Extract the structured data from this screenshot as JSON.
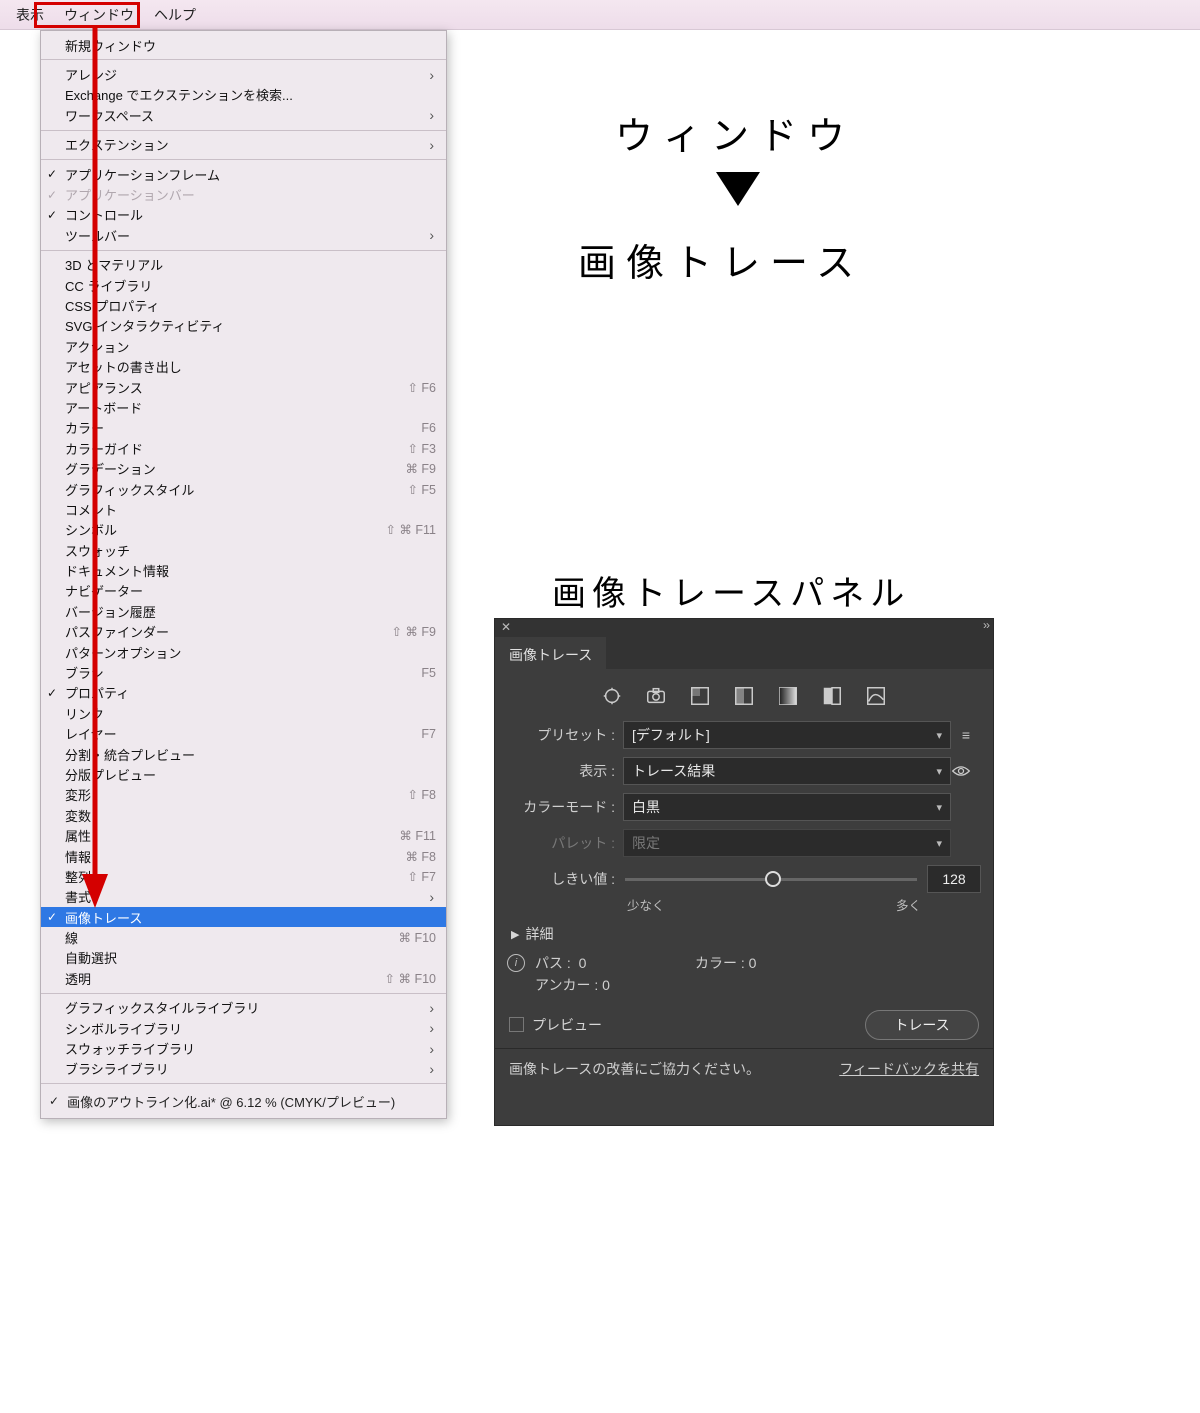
{
  "menubar": {
    "items": [
      "表示",
      "ウィンドウ",
      "ヘルプ"
    ]
  },
  "annotations": {
    "label1": "ウィンドウ",
    "label2": "画像トレース",
    "panel_title": "画像トレースパネル"
  },
  "menu": {
    "footer": "画像のアウトライン化.ai* @ 6.12 % (CMYK/プレビュー)",
    "items": [
      {
        "label": "新規ウィンドウ"
      },
      {
        "sep": true
      },
      {
        "label": "アレンジ",
        "arrow": true
      },
      {
        "label": "Exchange でエクステンションを検索..."
      },
      {
        "label": "ワークスペース",
        "arrow": true
      },
      {
        "sep": true
      },
      {
        "label": "エクステンション",
        "arrow": true
      },
      {
        "sep": true
      },
      {
        "label": "アプリケーションフレーム",
        "check": true
      },
      {
        "label": "アプリケーションバー",
        "check": true,
        "disabled": true
      },
      {
        "label": "コントロール",
        "check": true
      },
      {
        "label": "ツールバー",
        "arrow": true
      },
      {
        "sep": true
      },
      {
        "label": "3D とマテリアル"
      },
      {
        "label": "CC ライブラリ"
      },
      {
        "label": "CSS プロパティ"
      },
      {
        "label": "SVG インタラクティビティ"
      },
      {
        "label": "アクション"
      },
      {
        "label": "アセットの書き出し"
      },
      {
        "label": "アピアランス",
        "shortcut": "⇧ F6"
      },
      {
        "label": "アートボード"
      },
      {
        "label": "カラー",
        "shortcut": "F6"
      },
      {
        "label": "カラーガイド",
        "shortcut": "⇧ F3"
      },
      {
        "label": "グラデーション",
        "shortcut": "⌘ F9"
      },
      {
        "label": "グラフィックスタイル",
        "shortcut": "⇧ F5"
      },
      {
        "label": "コメント"
      },
      {
        "label": "シンボル",
        "shortcut": "⇧ ⌘ F11"
      },
      {
        "label": "スウォッチ"
      },
      {
        "label": "ドキュメント情報"
      },
      {
        "label": "ナビゲーター"
      },
      {
        "label": "バージョン履歴"
      },
      {
        "label": "パスファインダー",
        "shortcut": "⇧ ⌘ F9"
      },
      {
        "label": "パターンオプション"
      },
      {
        "label": "ブラシ",
        "shortcut": "F5"
      },
      {
        "label": "プロパティ",
        "check": true
      },
      {
        "label": "リンク"
      },
      {
        "label": "レイヤー",
        "shortcut": "F7"
      },
      {
        "label": "分割・統合プレビュー"
      },
      {
        "label": "分版プレビュー"
      },
      {
        "label": "変形",
        "shortcut": "⇧ F8"
      },
      {
        "label": "変数"
      },
      {
        "label": "属性",
        "shortcut": "⌘ F11"
      },
      {
        "label": "情報",
        "shortcut": "⌘ F8"
      },
      {
        "label": "整列",
        "shortcut": "⇧ F7"
      },
      {
        "label": "書式",
        "arrow": true
      },
      {
        "label": "画像トレース",
        "check": true,
        "selected": true
      },
      {
        "label": "線",
        "shortcut": "⌘ F10"
      },
      {
        "label": "自動選択"
      },
      {
        "label": "透明",
        "shortcut": "⇧ ⌘ F10"
      },
      {
        "sep": true
      },
      {
        "label": "グラフィックスタイルライブラリ",
        "arrow": true
      },
      {
        "label": "シンボルライブラリ",
        "arrow": true
      },
      {
        "label": "スウォッチライブラリ",
        "arrow": true
      },
      {
        "label": "ブラシライブラリ",
        "arrow": true
      }
    ]
  },
  "panel": {
    "tab": "画像トレース",
    "rows": {
      "preset": {
        "label": "プリセット :",
        "value": "[デフォルト]"
      },
      "display": {
        "label": "表示 :",
        "value": "トレース結果"
      },
      "colormode": {
        "label": "カラーモード :",
        "value": "白黒"
      },
      "palette": {
        "label": "パレット :",
        "value": "限定"
      },
      "threshold": {
        "label": "しきい値 :",
        "value": "128",
        "min_label": "少なく",
        "max_label": "多く"
      }
    },
    "detail_label": "詳細",
    "stats": {
      "path_label": "パス :",
      "path_value": "0",
      "color_label": "カラー :",
      "color_value": "0",
      "anchor_label": "アンカー :",
      "anchor_value": "0"
    },
    "preview_label": "プレビュー",
    "trace_button": "トレース",
    "feedback_msg": "画像トレースの改善にご協力ください。",
    "feedback_link": "フィードバックを共有"
  }
}
